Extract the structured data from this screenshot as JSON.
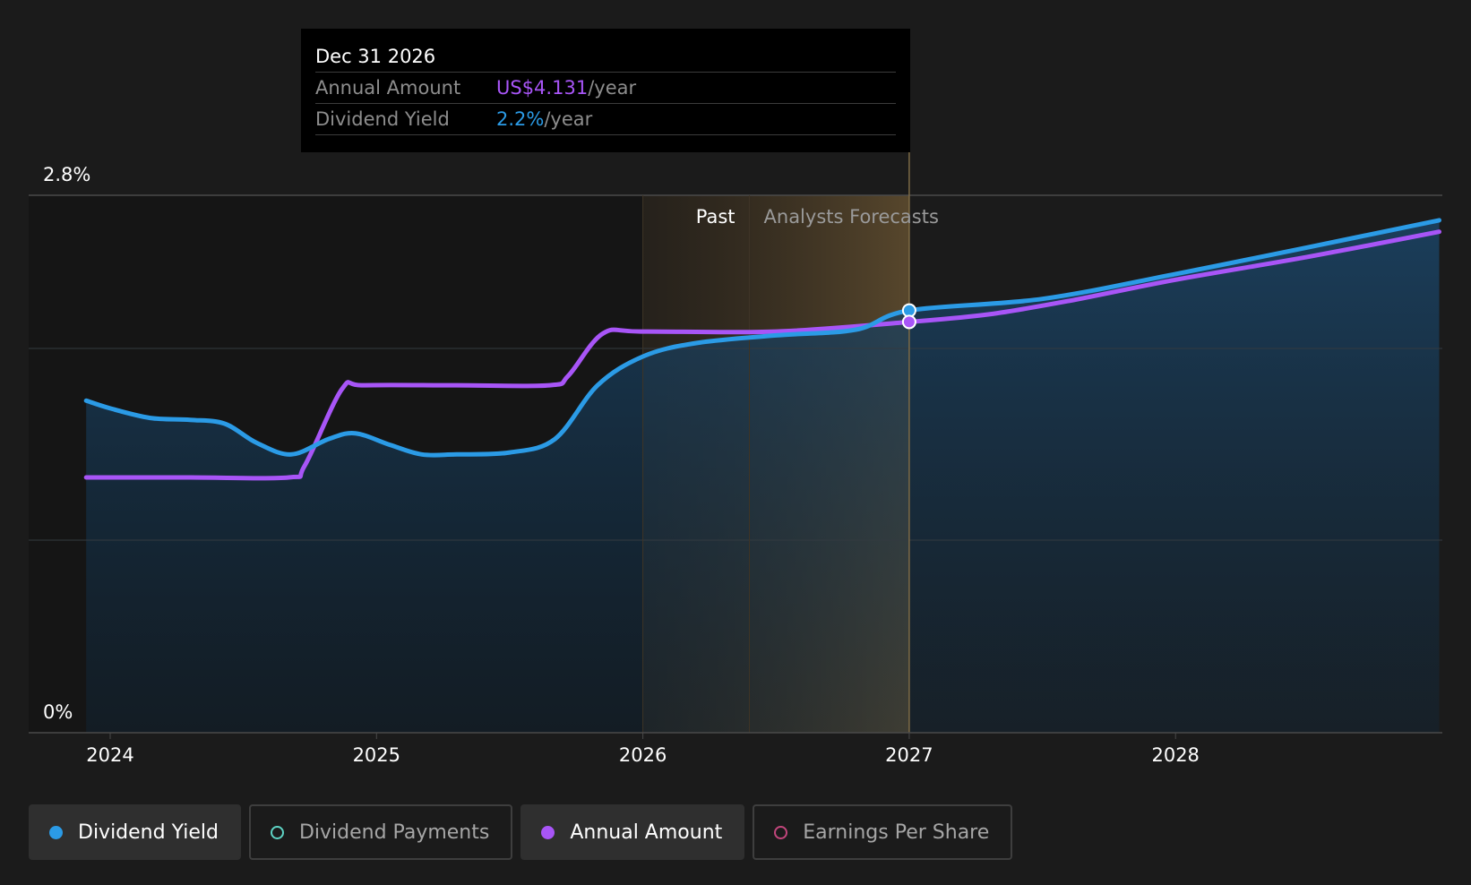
{
  "tooltip": {
    "date": "Dec 31 2026",
    "rows": [
      {
        "label": "Annual Amount",
        "value": "US$4.131",
        "unit": "/year",
        "color": "#a855f7"
      },
      {
        "label": "Dividend Yield",
        "value": "2.2%",
        "unit": "/year",
        "color": "#2b9be6"
      }
    ]
  },
  "region_labels": {
    "past": "Past",
    "forecast": "Analysts Forecasts"
  },
  "legend": [
    {
      "label": "Dividend Yield",
      "color": "#2b9be6",
      "active": true
    },
    {
      "label": "Dividend Payments",
      "color": "#5ed3c4",
      "active": false
    },
    {
      "label": "Annual Amount",
      "color": "#a855f7",
      "active": true
    },
    {
      "label": "Earnings Per Share",
      "color": "#c2467c",
      "active": false
    }
  ],
  "chart_data": {
    "type": "line",
    "y_tick_labels": [
      "2.8%",
      "0%"
    ],
    "ylim": [
      0,
      2.8
    ],
    "x_tick_labels": [
      "2024",
      "2025",
      "2026",
      "2027",
      "2028"
    ],
    "x_ticks": [
      2024,
      2025,
      2026,
      2027,
      2028
    ],
    "xlim": [
      2023.7,
      2028.99
    ],
    "past_end": 2026.0,
    "forecast_start": 2026.4,
    "cursor_x": 2027.0,
    "series": [
      {
        "name": "Dividend Yield",
        "color": "#2b9be6",
        "points": [
          [
            2023.91,
            1.73
          ],
          [
            2024.0,
            1.69
          ],
          [
            2024.15,
            1.64
          ],
          [
            2024.3,
            1.63
          ],
          [
            2024.43,
            1.61
          ],
          [
            2024.55,
            1.51
          ],
          [
            2024.68,
            1.45
          ],
          [
            2024.82,
            1.53
          ],
          [
            2024.92,
            1.56
          ],
          [
            2025.05,
            1.5
          ],
          [
            2025.17,
            1.45
          ],
          [
            2025.3,
            1.45
          ],
          [
            2025.5,
            1.46
          ],
          [
            2025.67,
            1.53
          ],
          [
            2025.83,
            1.81
          ],
          [
            2026.0,
            1.96
          ],
          [
            2026.2,
            2.03
          ],
          [
            2026.5,
            2.07
          ],
          [
            2026.8,
            2.1
          ],
          [
            2027.0,
            2.2
          ],
          [
            2027.5,
            2.26
          ],
          [
            2028.0,
            2.39
          ],
          [
            2028.5,
            2.53
          ],
          [
            2028.99,
            2.67
          ]
        ]
      },
      {
        "name": "Annual Amount",
        "color": "#a855f7",
        "points": [
          [
            2023.91,
            1.33
          ],
          [
            2024.3,
            1.33
          ],
          [
            2024.67,
            1.33
          ],
          [
            2024.73,
            1.39
          ],
          [
            2024.87,
            1.79
          ],
          [
            2024.95,
            1.81
          ],
          [
            2025.3,
            1.81
          ],
          [
            2025.65,
            1.81
          ],
          [
            2025.72,
            1.86
          ],
          [
            2025.85,
            2.08
          ],
          [
            2026.0,
            2.09
          ],
          [
            2026.5,
            2.09
          ],
          [
            2027.0,
            2.14
          ],
          [
            2027.3,
            2.18
          ],
          [
            2027.6,
            2.25
          ],
          [
            2028.0,
            2.36
          ],
          [
            2028.5,
            2.48
          ],
          [
            2028.99,
            2.61
          ]
        ]
      }
    ]
  }
}
